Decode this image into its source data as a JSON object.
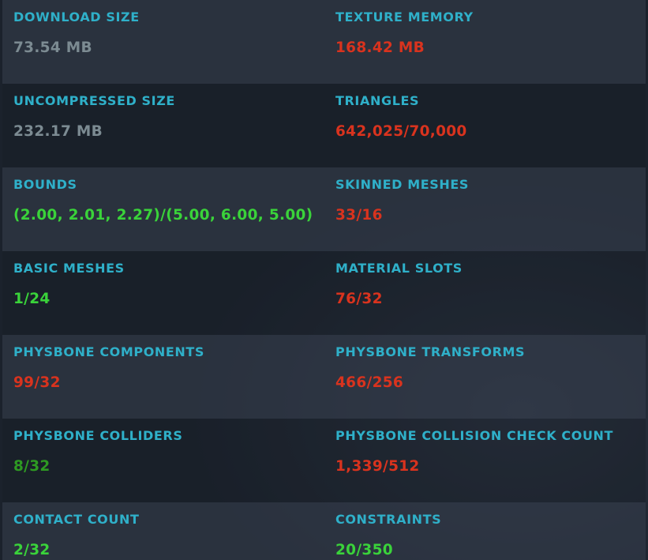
{
  "colors": {
    "label": "#2fb0c9",
    "neutral": "#7c8b92",
    "bad": "#d9331e",
    "good": "#3ad33a",
    "ok": "#2e9a22"
  },
  "stats": {
    "download_size": {
      "label": "DOWNLOAD SIZE",
      "value": "73.54 MB",
      "status": "neutral"
    },
    "texture_memory": {
      "label": "TEXTURE MEMORY",
      "value": "168.42 MB",
      "status": "bad"
    },
    "uncompressed_size": {
      "label": "UNCOMPRESSED SIZE",
      "value": "232.17 MB",
      "status": "neutral"
    },
    "triangles": {
      "label": "TRIANGLES",
      "value": "642,025/70,000",
      "status": "bad"
    },
    "bounds": {
      "label": "BOUNDS",
      "value": "(2.00, 2.01, 2.27)/(5.00, 6.00, 5.00)",
      "status": "good"
    },
    "skinned_meshes": {
      "label": "SKINNED MESHES",
      "value": "33/16",
      "status": "bad"
    },
    "basic_meshes": {
      "label": "BASIC MESHES",
      "value": "1/24",
      "status": "good"
    },
    "material_slots": {
      "label": "MATERIAL SLOTS",
      "value": "76/32",
      "status": "bad"
    },
    "physbone_components": {
      "label": "PHYSBONE COMPONENTS",
      "value": "99/32",
      "status": "bad"
    },
    "physbone_transforms": {
      "label": "PHYSBONE TRANSFORMS",
      "value": "466/256",
      "status": "bad"
    },
    "physbone_colliders": {
      "label": "PHYSBONE COLLIDERS",
      "value": "8/32",
      "status": "ok"
    },
    "physbone_collision_check_count": {
      "label": "PHYSBONE COLLISION CHECK COUNT",
      "value": "1,339/512",
      "status": "bad"
    },
    "contact_count": {
      "label": "CONTACT COUNT",
      "value": "2/32",
      "status": "good"
    },
    "constraints": {
      "label": "CONSTRAINTS",
      "value": "20/350",
      "status": "good"
    }
  }
}
